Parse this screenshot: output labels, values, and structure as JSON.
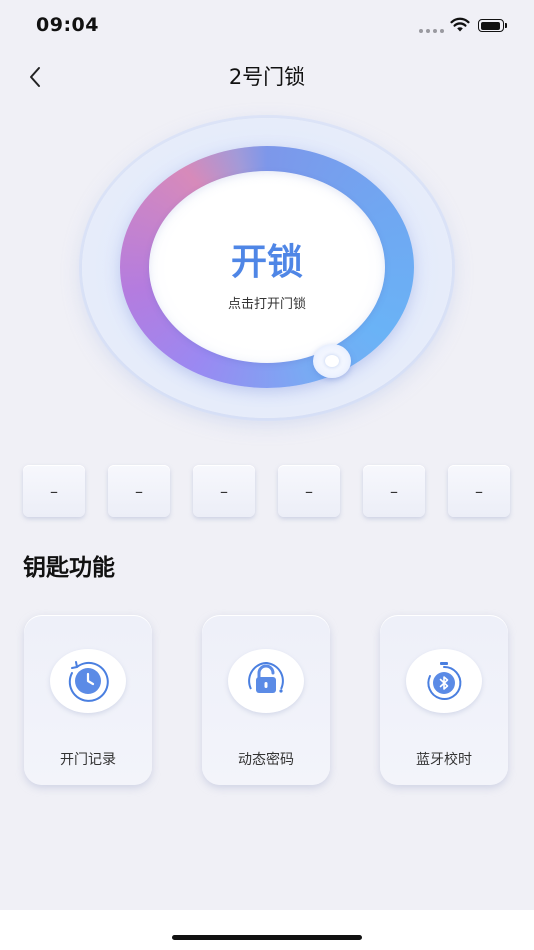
{
  "status_bar": {
    "time": "09:04",
    "icons": [
      "signal-dots-icon",
      "wifi-icon",
      "battery-icon"
    ]
  },
  "nav": {
    "back_icon": "chevron-left-icon",
    "title": "2号门锁"
  },
  "unlock": {
    "label": "开锁",
    "hint": "点击打开门锁"
  },
  "code_boxes": [
    "–",
    "–",
    "–",
    "–",
    "–",
    "–"
  ],
  "section": {
    "title": "钥匙功能"
  },
  "functions": [
    {
      "label": "开门记录",
      "icon": "clock-history-icon"
    },
    {
      "label": "动态密码",
      "icon": "padlock-icon"
    },
    {
      "label": "蓝牙校时",
      "icon": "bluetooth-timer-icon"
    }
  ],
  "colors": {
    "accent": "#4f86e6",
    "background": "#f0f0f6",
    "ring_gradient": [
      "#6ab3f6",
      "#9a89f2",
      "#d78aba"
    ]
  }
}
